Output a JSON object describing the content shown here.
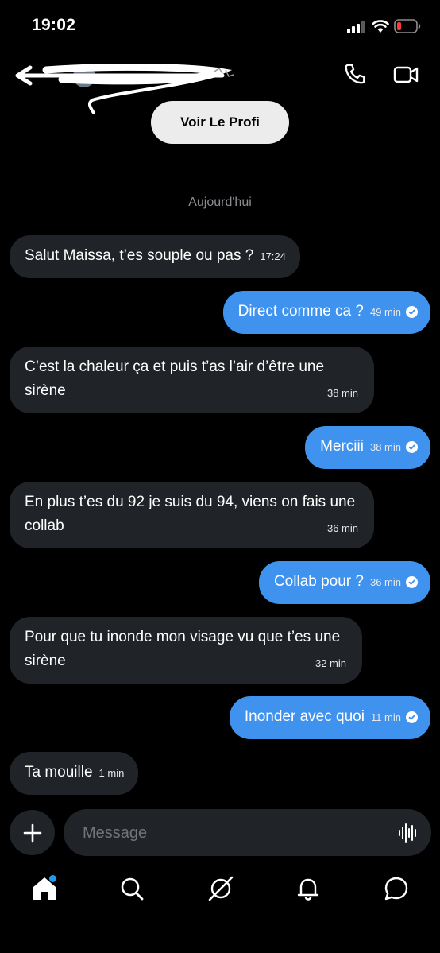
{
  "status_bar": {
    "time": "19:02"
  },
  "header": {
    "profile_button_label": "Voir Le Profi"
  },
  "date_separator": "Aujourd'hui",
  "messages": [
    {
      "direction": "in",
      "text": "Salut Maissa, t’es souple ou pas ?",
      "time": "17:24"
    },
    {
      "direction": "out",
      "text": "Direct comme ca ?",
      "time": "49 min",
      "read": true
    },
    {
      "direction": "in",
      "text": "C’est la chaleur ça et puis t’as l’air d’être une sirène",
      "time": "38 min"
    },
    {
      "direction": "out",
      "text": "Merciii",
      "time": "38 min",
      "read": true
    },
    {
      "direction": "in",
      "text": "En plus t’es du 92 je suis du 94, viens on fais une collab",
      "time": "36 min"
    },
    {
      "direction": "out",
      "text": "Collab pour ?",
      "time": "36 min",
      "read": true
    },
    {
      "direction": "in",
      "text": "Pour que tu inonde mon visage vu que t’es une sirène",
      "time": "32 min"
    },
    {
      "direction": "out",
      "text": "Inonder avec quoi",
      "time": "11 min",
      "read": true
    },
    {
      "direction": "in",
      "text": "Ta mouille",
      "time": "1 min"
    }
  ],
  "composer": {
    "placeholder": "Message"
  },
  "icons": {
    "status": [
      "signal-icon",
      "wifi-icon",
      "battery-icon"
    ],
    "header": [
      "back-arrow-icon",
      "phone-icon",
      "video-call-icon"
    ],
    "nav": [
      "home-icon",
      "search-icon",
      "grok-icon",
      "notifications-icon",
      "messages-icon"
    ]
  },
  "colors": {
    "outgoing_bubble": "#3f92ee",
    "incoming_bubble": "#202327",
    "battery_low": "#ff3b30",
    "nav_badge": "#1d9bf0"
  }
}
